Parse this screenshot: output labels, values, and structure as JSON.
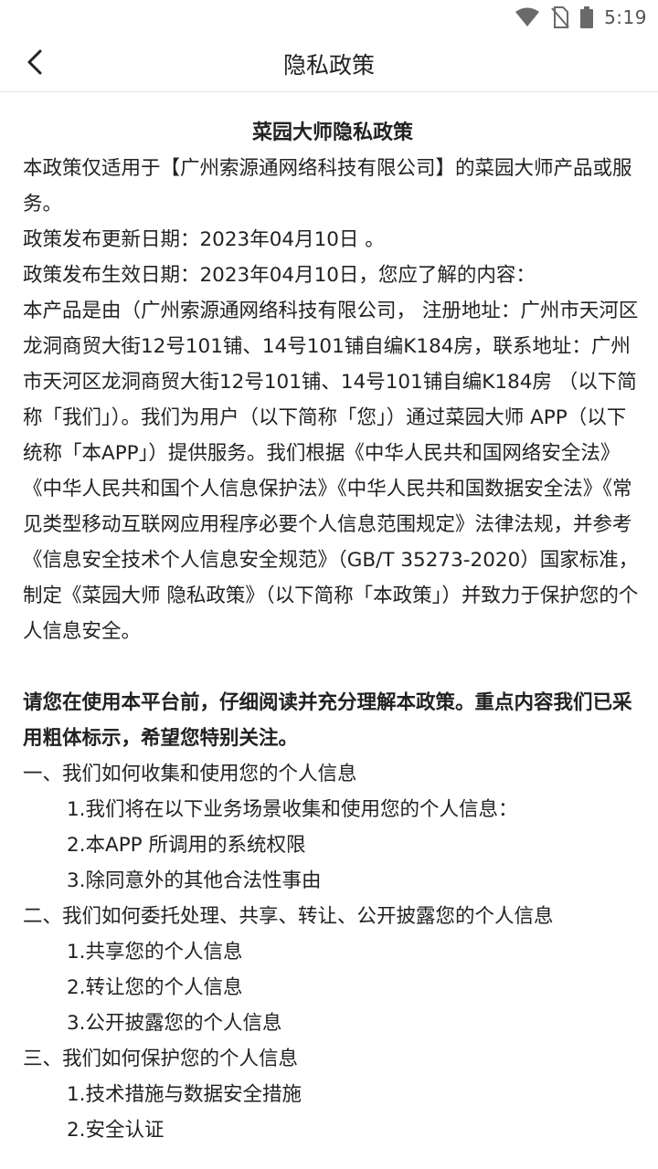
{
  "status_bar": {
    "time": "5:19",
    "icons": [
      "wifi-icon",
      "no-sim-icon",
      "battery-icon"
    ]
  },
  "nav": {
    "back_icon": "chevron-left-icon",
    "title": "隐私政策"
  },
  "doc": {
    "title": "菜园大师隐私政策",
    "intro": [
      "本政策仅适用于【广州索源通网络科技有限公司】的菜园大师产品或服务。",
      "政策发布更新日期：2023年04月10日 。",
      "政策发布生效日期：2023年04月10日，您应了解的内容：",
      "本产品是由（广州索源通网络科技有限公司， 注册地址：广州市天河区龙洞商贸大街12号101铺、14号101铺自编K184房，联系地址：广州市天河区龙洞商贸大街12号101铺、14号101铺自编K184房 （以下简称「我们」）。我们为用户（以下简称「您」）通过菜园大师 APP（以下统称「本APP」）提供服务。我们根据《中华人民共和国网络安全法》《中华人民共和国个人信息保护法》《中华人民共和国数据安全法》《常见类型移动互联网应用程序必要个人信息范围规定》法律法规，并参考《信息安全技术个人信息安全规范》（GB/T 35273-2020）国家标准，制定《菜园大师 隐私政策》（以下简称「本政策」）并致力于保护您的个人信息安全。"
    ],
    "notice_bold": "请您在使用本平台前，仔细阅读并充分理解本政策。重点内容我们已采用粗体标示，希望您特别关注。",
    "toc": [
      {
        "heading": "一、我们如何收集和使用您的个人信息",
        "items": [
          "1.我们将在以下业务场景收集和使用您的个人信息：",
          "2.本APP 所调用的系统权限",
          "3.除同意外的其他合法性事由"
        ]
      },
      {
        "heading": "二、我们如何委托处理、共享、转让、公开披露您的个人信息",
        "items": [
          "1.共享您的个人信息",
          "2.转让您的个人信息",
          "3.公开披露您的个人信息"
        ]
      },
      {
        "heading": "三、我们如何保护您的个人信息",
        "items": [
          "1.技术措施与数据安全措施",
          "2.安全认证"
        ]
      }
    ]
  }
}
